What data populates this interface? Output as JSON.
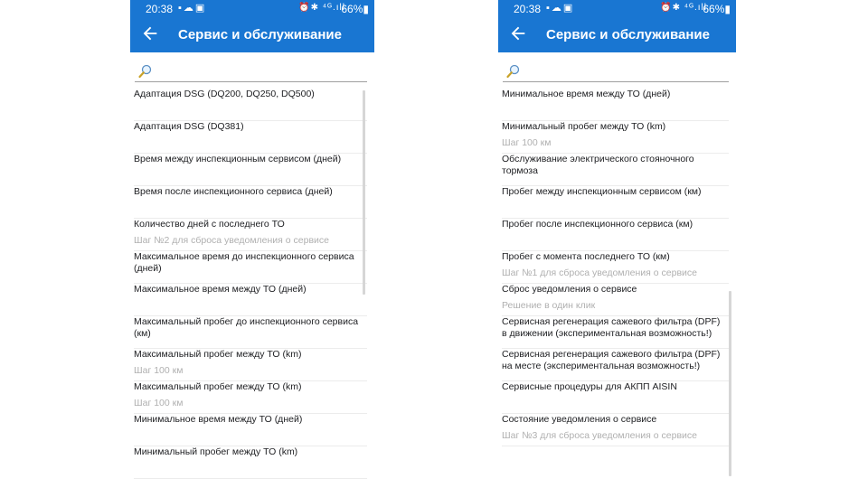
{
  "status_bar": {
    "time": "20:38",
    "left_icons": "▪☁▣",
    "right_icons": "⏰✱ ⁴ᴳ.ıll",
    "battery": "66%▮"
  },
  "header": {
    "title": "Сервис и обслуживание"
  },
  "search": {
    "placeholder": ""
  },
  "left_list": [
    {
      "title": "Адаптация DSG (DQ200, DQ250, DQ500)",
      "sub": ""
    },
    {
      "title": "Адаптация DSG (DQ381)",
      "sub": ""
    },
    {
      "title": "Время между инспекционным сервисом (дней)",
      "sub": ""
    },
    {
      "title": "Время после инспекционного сервиса (дней)",
      "sub": ""
    },
    {
      "title": "Количество дней с последнего ТО",
      "sub": "Шаг №2 для сброса уведомления о сервисе"
    },
    {
      "title": "Максимальное время до инспекционного сервиса (дней)",
      "sub": ""
    },
    {
      "title": "Максимальное время между ТО (дней)",
      "sub": ""
    },
    {
      "title": "Максимальный пробег до инспекционного сервиса (км)",
      "sub": ""
    },
    {
      "title": "Максимальный пробег между ТО (km)",
      "sub": "Шаг 100 км"
    },
    {
      "title": "Максимальный пробег между ТО (km)",
      "sub": "Шаг 100 км"
    },
    {
      "title": "Минимальное время между ТО (дней)",
      "sub": ""
    },
    {
      "title": "Минимальный пробег между ТО (km)",
      "sub": ""
    }
  ],
  "right_list": [
    {
      "title": "Минимальное время между ТО (дней)",
      "sub": ""
    },
    {
      "title": "Минимальный пробег между ТО (km)",
      "sub": "Шаг 100 км"
    },
    {
      "title": "Обслуживание электрического стояночного тормоза",
      "sub": ""
    },
    {
      "title": "Пробег между инспекционным сервисом (км)",
      "sub": ""
    },
    {
      "title": "Пробег после инспекционного сервиса (км)",
      "sub": ""
    },
    {
      "title": "Пробег с момента последнего ТО (км)",
      "sub": "Шаг №1 для сброса уведомления о сервисе"
    },
    {
      "title": "Сброс уведомления о сервисе",
      "sub": "Решение в один клик"
    },
    {
      "title": "Сервисная регенерация сажевого фильтра (DPF) в движении (экспериментальная возможность!)",
      "sub": ""
    },
    {
      "title": "Сервисная регенерация сажевого фильтра (DPF) на месте (экспериментальная возможность!)",
      "sub": ""
    },
    {
      "title": "Сервисные процедуры для АКПП AISIN",
      "sub": ""
    },
    {
      "title": "Состояние уведомления о сервисе",
      "sub": "Шаг №3 для сброса уведомления о сервисе"
    }
  ],
  "colors": {
    "appbar": "#1976d2",
    "text": "#202124",
    "subtext": "#b0b0b0"
  }
}
